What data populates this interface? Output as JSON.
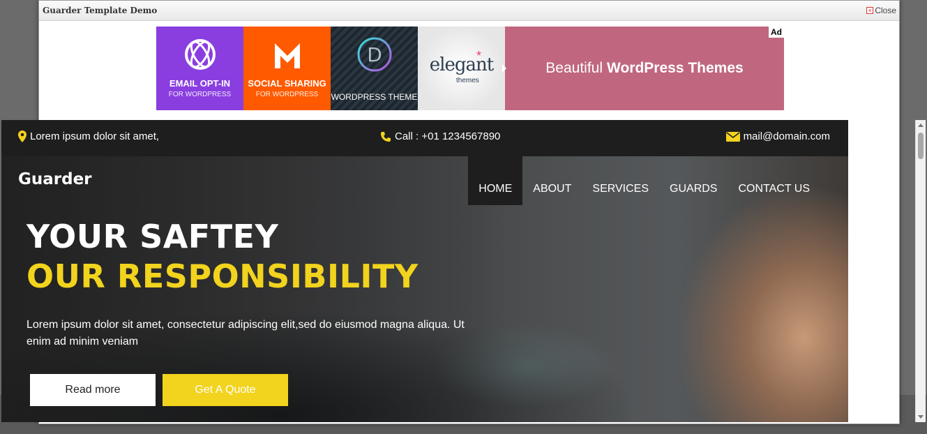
{
  "modal": {
    "title": "Guarder Template Demo",
    "close_label": "Close"
  },
  "ad": {
    "tiles": [
      {
        "line1": "EMAIL OPT-IN",
        "line2": "FOR WORDPRESS"
      },
      {
        "line1": "SOCIAL SHARING",
        "line2": "FOR WORDPRESS"
      },
      {
        "line1": "WORDPRESS THEME",
        "logo_letter": "D"
      },
      {
        "word": "elegant",
        "sub": "themes"
      }
    ],
    "pink_prefix": "Beautiful",
    "pink_bold": "WordPress Themes",
    "label": "Ad",
    "colors": {
      "purple": "#8a3ee0",
      "orange": "#ff5a00",
      "pink": "#c0677f"
    }
  },
  "topbar": {
    "address": "Lorem ipsum dolor sit amet,",
    "call": "Call : +01 1234567890",
    "email": "mail@domain.com",
    "icon_color": "#f2d31d"
  },
  "header": {
    "brand": "Guarder",
    "nav": [
      "HOME",
      "ABOUT",
      "SERVICES",
      "GUARDS",
      "CONTACT US"
    ]
  },
  "hero": {
    "headline_1": "YOUR SAFTEY",
    "headline_2": "OUR RESPONSIBILITY",
    "text": "Lorem ipsum dolor sit amet, consectetur adipiscing elit,sed do eiusmod magna aliqua. Ut enim ad minim veniam",
    "read_more": "Read more",
    "quote": "Get A Quote",
    "accent": "#f2d31d"
  }
}
